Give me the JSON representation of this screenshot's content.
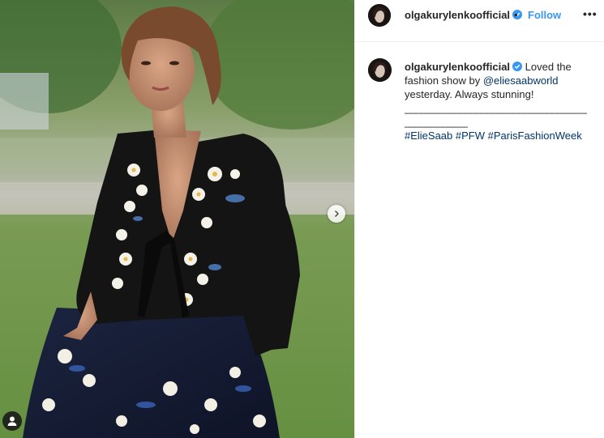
{
  "post": {
    "username": "olgakurylenkoofficial",
    "separator": "•",
    "follow_label": "Follow",
    "more_label": "•••",
    "caption": {
      "username": "olgakurylenkoofficial",
      "text_before": " Loved the fashion show by ",
      "mention": "@eliesaabworld",
      "text_after": " yesterday. Always stunning!",
      "rule_1": "________________________________________",
      "rule_2": "______________",
      "hashtags": [
        "#ElieSaab",
        "#PFW",
        "#ParisFashionWeek"
      ]
    }
  },
  "colors": {
    "link_blue": "#3897f0",
    "verified_blue": "#3897f0",
    "hashtag_navy": "#003569"
  },
  "icons": {
    "verified": "verified-badge-icon",
    "next": "chevron-right-icon",
    "user_tag": "person-icon"
  }
}
